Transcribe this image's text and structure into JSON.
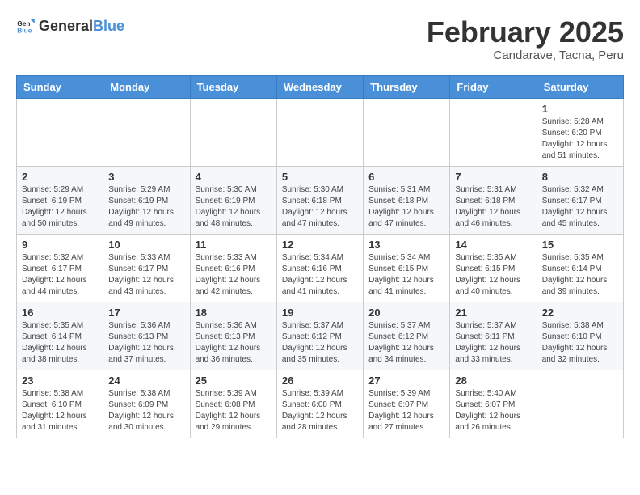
{
  "logo": {
    "general": "General",
    "blue": "Blue"
  },
  "header": {
    "title": "February 2025",
    "subtitle": "Candarave, Tacna, Peru"
  },
  "weekdays": [
    "Sunday",
    "Monday",
    "Tuesday",
    "Wednesday",
    "Thursday",
    "Friday",
    "Saturday"
  ],
  "weeks": [
    [
      {
        "day": "",
        "info": ""
      },
      {
        "day": "",
        "info": ""
      },
      {
        "day": "",
        "info": ""
      },
      {
        "day": "",
        "info": ""
      },
      {
        "day": "",
        "info": ""
      },
      {
        "day": "",
        "info": ""
      },
      {
        "day": "1",
        "info": "Sunrise: 5:28 AM\nSunset: 6:20 PM\nDaylight: 12 hours and 51 minutes."
      }
    ],
    [
      {
        "day": "2",
        "info": "Sunrise: 5:29 AM\nSunset: 6:19 PM\nDaylight: 12 hours and 50 minutes."
      },
      {
        "day": "3",
        "info": "Sunrise: 5:29 AM\nSunset: 6:19 PM\nDaylight: 12 hours and 49 minutes."
      },
      {
        "day": "4",
        "info": "Sunrise: 5:30 AM\nSunset: 6:19 PM\nDaylight: 12 hours and 48 minutes."
      },
      {
        "day": "5",
        "info": "Sunrise: 5:30 AM\nSunset: 6:18 PM\nDaylight: 12 hours and 47 minutes."
      },
      {
        "day": "6",
        "info": "Sunrise: 5:31 AM\nSunset: 6:18 PM\nDaylight: 12 hours and 47 minutes."
      },
      {
        "day": "7",
        "info": "Sunrise: 5:31 AM\nSunset: 6:18 PM\nDaylight: 12 hours and 46 minutes."
      },
      {
        "day": "8",
        "info": "Sunrise: 5:32 AM\nSunset: 6:17 PM\nDaylight: 12 hours and 45 minutes."
      }
    ],
    [
      {
        "day": "9",
        "info": "Sunrise: 5:32 AM\nSunset: 6:17 PM\nDaylight: 12 hours and 44 minutes."
      },
      {
        "day": "10",
        "info": "Sunrise: 5:33 AM\nSunset: 6:17 PM\nDaylight: 12 hours and 43 minutes."
      },
      {
        "day": "11",
        "info": "Sunrise: 5:33 AM\nSunset: 6:16 PM\nDaylight: 12 hours and 42 minutes."
      },
      {
        "day": "12",
        "info": "Sunrise: 5:34 AM\nSunset: 6:16 PM\nDaylight: 12 hours and 41 minutes."
      },
      {
        "day": "13",
        "info": "Sunrise: 5:34 AM\nSunset: 6:15 PM\nDaylight: 12 hours and 41 minutes."
      },
      {
        "day": "14",
        "info": "Sunrise: 5:35 AM\nSunset: 6:15 PM\nDaylight: 12 hours and 40 minutes."
      },
      {
        "day": "15",
        "info": "Sunrise: 5:35 AM\nSunset: 6:14 PM\nDaylight: 12 hours and 39 minutes."
      }
    ],
    [
      {
        "day": "16",
        "info": "Sunrise: 5:35 AM\nSunset: 6:14 PM\nDaylight: 12 hours and 38 minutes."
      },
      {
        "day": "17",
        "info": "Sunrise: 5:36 AM\nSunset: 6:13 PM\nDaylight: 12 hours and 37 minutes."
      },
      {
        "day": "18",
        "info": "Sunrise: 5:36 AM\nSunset: 6:13 PM\nDaylight: 12 hours and 36 minutes."
      },
      {
        "day": "19",
        "info": "Sunrise: 5:37 AM\nSunset: 6:12 PM\nDaylight: 12 hours and 35 minutes."
      },
      {
        "day": "20",
        "info": "Sunrise: 5:37 AM\nSunset: 6:12 PM\nDaylight: 12 hours and 34 minutes."
      },
      {
        "day": "21",
        "info": "Sunrise: 5:37 AM\nSunset: 6:11 PM\nDaylight: 12 hours and 33 minutes."
      },
      {
        "day": "22",
        "info": "Sunrise: 5:38 AM\nSunset: 6:10 PM\nDaylight: 12 hours and 32 minutes."
      }
    ],
    [
      {
        "day": "23",
        "info": "Sunrise: 5:38 AM\nSunset: 6:10 PM\nDaylight: 12 hours and 31 minutes."
      },
      {
        "day": "24",
        "info": "Sunrise: 5:38 AM\nSunset: 6:09 PM\nDaylight: 12 hours and 30 minutes."
      },
      {
        "day": "25",
        "info": "Sunrise: 5:39 AM\nSunset: 6:08 PM\nDaylight: 12 hours and 29 minutes."
      },
      {
        "day": "26",
        "info": "Sunrise: 5:39 AM\nSunset: 6:08 PM\nDaylight: 12 hours and 28 minutes."
      },
      {
        "day": "27",
        "info": "Sunrise: 5:39 AM\nSunset: 6:07 PM\nDaylight: 12 hours and 27 minutes."
      },
      {
        "day": "28",
        "info": "Sunrise: 5:40 AM\nSunset: 6:07 PM\nDaylight: 12 hours and 26 minutes."
      },
      {
        "day": "",
        "info": ""
      }
    ]
  ]
}
